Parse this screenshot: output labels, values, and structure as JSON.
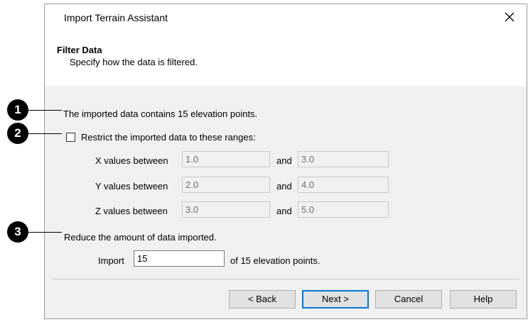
{
  "dialog": {
    "title": "Import Terrain Assistant",
    "close_icon": "close-icon",
    "step_title": "Filter Data",
    "step_description": "Specify how the data is filtered."
  },
  "content": {
    "info_text": "The imported data contains 15 elevation points.",
    "restrict_label": "Restrict the imported data to these ranges:",
    "restrict_checked": false,
    "and_label": "and",
    "ranges": [
      {
        "label": "X values between",
        "min": "1.0",
        "max": "3.0"
      },
      {
        "label": "Y values between",
        "min": "2.0",
        "max": "4.0"
      },
      {
        "label": "Z values between",
        "min": "3.0",
        "max": "5.0"
      }
    ],
    "reduce_label": "Reduce the amount of data imported.",
    "import_label": "Import",
    "import_value": "15",
    "import_suffix": "of  15  elevation points."
  },
  "buttons": {
    "back": "< Back",
    "next": "Next >",
    "cancel": "Cancel",
    "help": "Help"
  },
  "callouts": [
    "1",
    "2",
    "3"
  ]
}
